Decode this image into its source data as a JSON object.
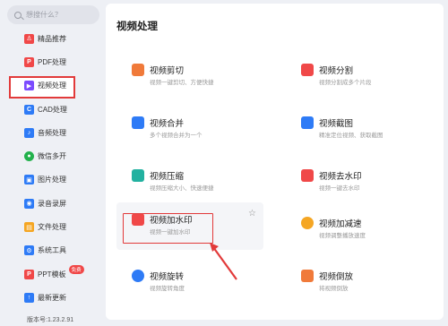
{
  "search": {
    "placeholder": "想搜什么？"
  },
  "sidebar": {
    "items": [
      {
        "label": "精品推荐",
        "icon": "recommend-icon",
        "color": "#f04848"
      },
      {
        "label": "PDF处理",
        "icon": "pdf-icon",
        "color": "#f04848"
      },
      {
        "label": "视频处理",
        "icon": "video-icon",
        "color": "#7b4bff",
        "active": true
      },
      {
        "label": "CAD处理",
        "icon": "cad-icon",
        "color": "#2e7bf6"
      },
      {
        "label": "音频处理",
        "icon": "audio-icon",
        "color": "#2e7bf6"
      },
      {
        "label": "微信多开",
        "icon": "wechat-icon",
        "color": "#22b14c"
      },
      {
        "label": "图片处理",
        "icon": "image-icon",
        "color": "#2e7bf6"
      },
      {
        "label": "录音录屏",
        "icon": "record-icon",
        "color": "#2e7bf6"
      },
      {
        "label": "文件处理",
        "icon": "file-icon",
        "color": "#f5a623"
      },
      {
        "label": "系统工具",
        "icon": "system-icon",
        "color": "#2e7bf6"
      },
      {
        "label": "PPT模板",
        "icon": "ppt-icon",
        "color": "#f04848",
        "badge": "免费"
      },
      {
        "label": "最新更新",
        "icon": "update-icon",
        "color": "#2e7bf6"
      }
    ],
    "version": "版本号:1.23.2.91"
  },
  "main": {
    "title": "视频处理",
    "cards": [
      {
        "title": "视频剪切",
        "desc": "视频一键剪切、方便快捷",
        "icon": "video-cut-icon",
        "color": "#f07a3a"
      },
      {
        "title": "视频分割",
        "desc": "视频分割成多个片段",
        "icon": "video-split-icon",
        "color": "#f04848"
      },
      {
        "title": "视频合并",
        "desc": "多个视频合并为一个",
        "icon": "video-merge-icon",
        "color": "#2e7bf6"
      },
      {
        "title": "视频截图",
        "desc": "精准定位视频、获取截图",
        "icon": "video-screenshot-icon",
        "color": "#2e7bf6"
      },
      {
        "title": "视频压缩",
        "desc": "视频压缩大小、快速便捷",
        "icon": "video-compress-icon",
        "color": "#22b1a0"
      },
      {
        "title": "视频去水印",
        "desc": "视频一键去水印",
        "icon": "remove-watermark-icon",
        "color": "#f04848"
      },
      {
        "title": "视频加水印",
        "desc": "视频一键加水印",
        "icon": "add-watermark-icon",
        "color": "#f04848",
        "highlighted": true
      },
      {
        "title": "视频加减速",
        "desc": "视频调整播放速度",
        "icon": "video-speed-icon",
        "color": "#f5a623"
      },
      {
        "title": "视频旋转",
        "desc": "视频旋转角度",
        "icon": "video-rotate-icon",
        "color": "#2e7bf6"
      },
      {
        "title": "视频倒放",
        "desc": "将视频倒放",
        "icon": "video-reverse-icon",
        "color": "#f07a3a"
      }
    ],
    "favorite_icon": "star-icon"
  },
  "annotation": {
    "color": "#e23a3a"
  }
}
